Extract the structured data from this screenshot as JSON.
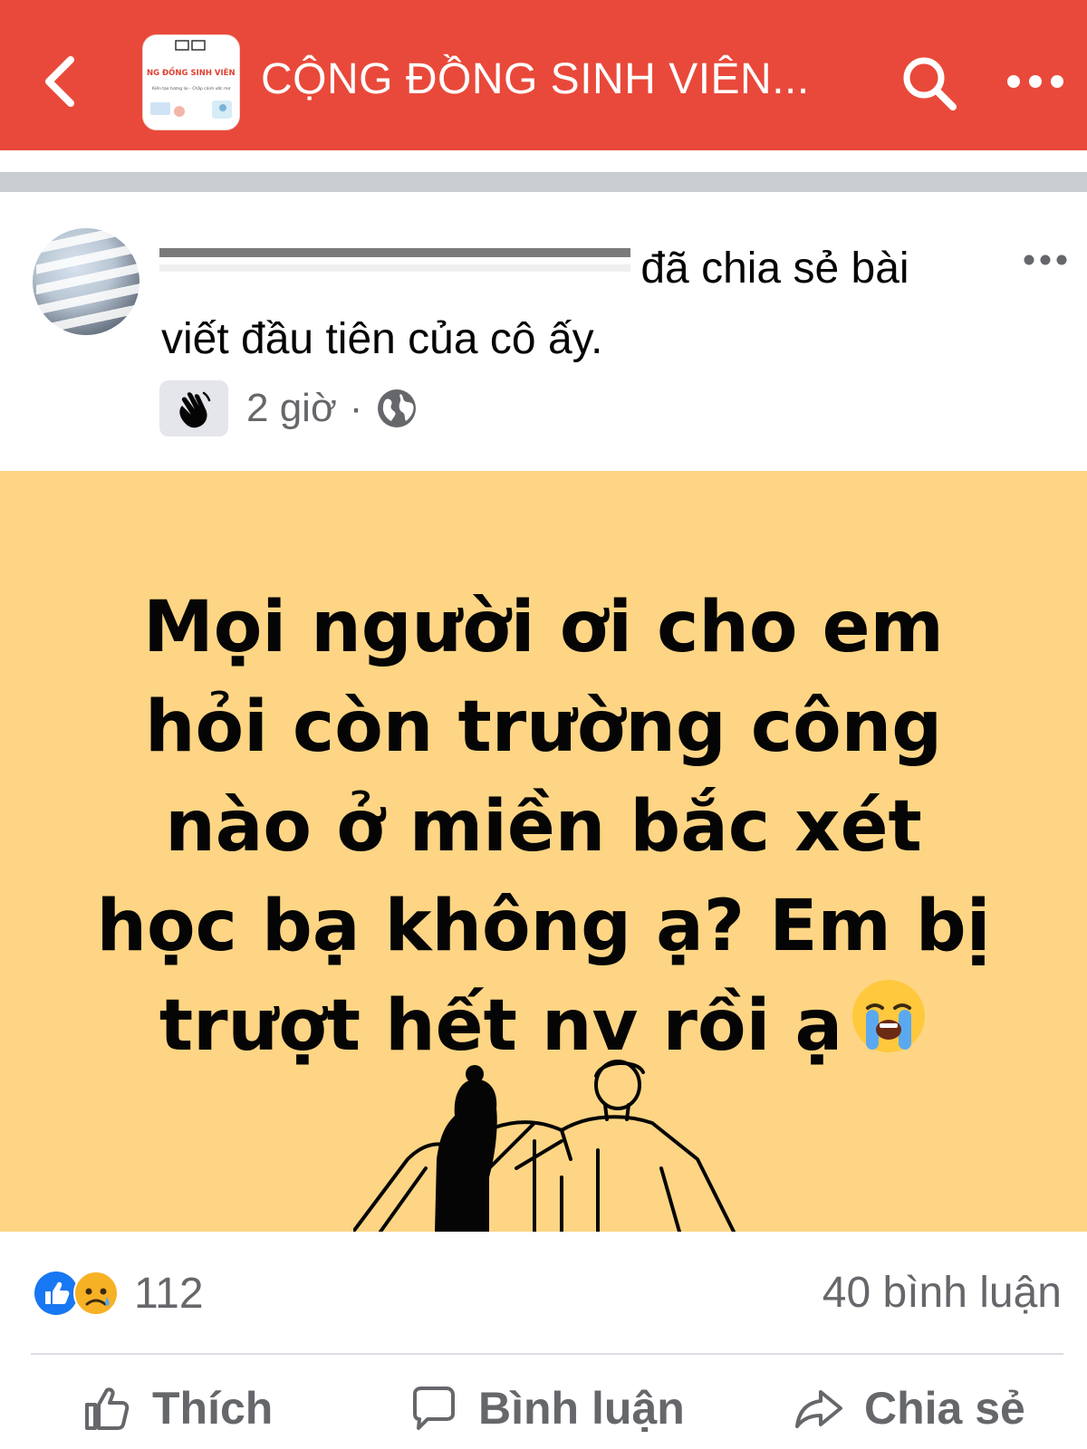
{
  "header": {
    "title": "CỘNG ĐỒNG SINH VIÊN...",
    "thumb_banner": "NG ĐỒNG SINH VIÊN",
    "thumb_caption": "Kiến tạo tương lai - Chắp cánh ước mơ",
    "bg_color": "#e9493a"
  },
  "post": {
    "share_text": "đã chia sẻ bài viết đầu tiên của cô ấy.",
    "time": "2 giờ",
    "separator": "·",
    "body_lines": [
      "Mọi người ơi cho em",
      "hỏi còn trường công",
      "nào ở miền bắc xét",
      "học bạ không ạ? Em bị",
      "trượt hết nv rồi ạ"
    ],
    "body_bg": "#fdd584"
  },
  "stats": {
    "reaction_count": "112",
    "comments": "40 bình luận"
  },
  "actions": {
    "like": "Thích",
    "comment": "Bình luận",
    "share": "Chia sẻ"
  }
}
